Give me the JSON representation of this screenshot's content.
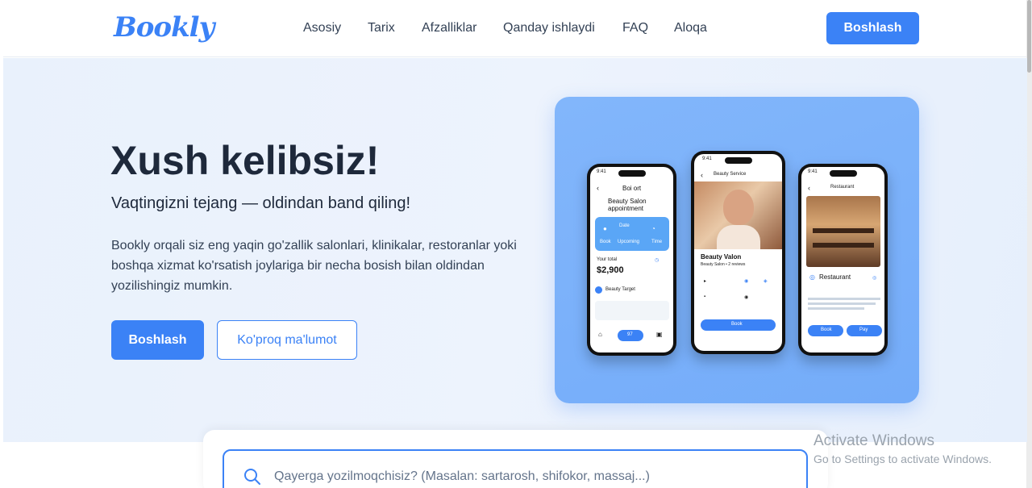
{
  "header": {
    "logo": "Bookly",
    "nav": [
      "Asosiy",
      "Tarix",
      "Afzalliklar",
      "Qanday ishlaydi",
      "FAQ",
      "Aloqa"
    ],
    "cta_label": "Boshlash"
  },
  "hero": {
    "title": "Xush kelibsiz!",
    "subtitle": "Vaqtingizni tejang — oldindan band qiling!",
    "description": "Bookly orqali siz eng yaqin go'zallik salonlari, klinikalar, restoranlar yoki boshqa xizmat ko'rsatish joylariga bir necha bosish bilan oldindan yozilishingiz mumkin.",
    "primary_button": "Boshlash",
    "secondary_button": "Ko'proq ma'lumot"
  },
  "showcase": {
    "phone1": {
      "time": "9:41",
      "header": "Boi ort",
      "title_line1": "Beauty Salon",
      "title_line2": "appointment",
      "card_date": "Date",
      "card_label1": "Book",
      "card_label2": "Upcoming",
      "card_label3": "Time",
      "price_label": "Your total",
      "price": "$2,900",
      "confirm": "Beauty Target",
      "tab_center": "97"
    },
    "phone2": {
      "time": "9:41",
      "header": "Beauty Service",
      "salon_name": "Beauty Valon",
      "salon_info": "Beauty Salon • 2 reviews",
      "button": "Book"
    },
    "phone3": {
      "time": "9:41",
      "header": "Restaurant",
      "name": "Restaurant",
      "btn_left": "Book",
      "btn_right": "Pay"
    }
  },
  "search": {
    "placeholder": "Qayerga yozilmoqchisiz? (Masalan: sartarosh, shifokor, massaj...)"
  },
  "watermark": {
    "title": "Activate Windows",
    "subtitle": "Go to Settings to activate Windows."
  },
  "colors": {
    "accent": "#3b82f6",
    "hero_bg": "#eaf2fd",
    "showcase_bg": "#7db2fa",
    "text_dark": "#1e293b"
  }
}
